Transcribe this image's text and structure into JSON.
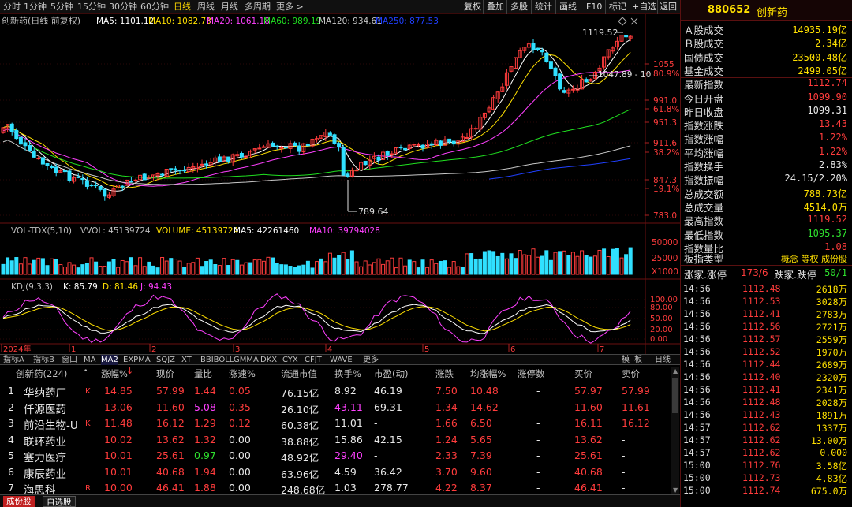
{
  "toolbar": {
    "periods": [
      "分时",
      "1分钟",
      "5分钟",
      "15分钟",
      "30分钟",
      "60分钟",
      "日线",
      "周线",
      "月线",
      "多周期",
      "更多 >"
    ],
    "active_period": "日线",
    "right_buttons": [
      "复权",
      "叠加",
      "多股",
      "统计",
      "画线",
      "F10",
      "标记",
      "+自选",
      "返回"
    ]
  },
  "chart": {
    "title": "创新药(日线 前复权)",
    "ma_labels": [
      {
        "text": "MA5: 1101.12",
        "color": "#ffffff"
      },
      {
        "text": "MA10: 1082.73",
        "color": "#ffe000"
      },
      {
        "text": "MA20: 1061.18",
        "color": "#ff40ff"
      },
      {
        "text": "MA60: 989.19",
        "color": "#20e020"
      },
      {
        "text": "MA120: 934.61",
        "color": "#c8c8c8"
      },
      {
        "text": "MA250: 877.53",
        "color": "#2040ff"
      }
    ],
    "price_axis": [
      "1055",
      "80.9%",
      "991.0",
      "61.8%",
      "951.3",
      "911.6",
      "38.2%",
      "847.3",
      "19.1%",
      "783.0"
    ],
    "high_label": "1119.52",
    "low_label": "789.64",
    "mid_label": "1047.89 - 10",
    "vol_labels": [
      {
        "text": "VOL-TDX(5,10)",
        "color": "#c0c0c0"
      },
      {
        "text": "VVOL: 45139724",
        "color": "#c0c0c0"
      },
      {
        "text": "VOLUME: 45139724",
        "color": "#ffe000"
      },
      {
        "text": "MA5: 42261460",
        "color": "#ffffff"
      },
      {
        "text": "MA10: 39794028",
        "color": "#ff40ff"
      }
    ],
    "vol_axis": [
      "50000",
      "25000",
      "X1000"
    ],
    "kdj_labels": [
      {
        "text": "KDJ(9,3,3)",
        "color": "#c0c0c0"
      },
      {
        "text": "K: 85.79",
        "color": "#ffffff"
      },
      {
        "text": "D: 81.46",
        "color": "#ffe000"
      },
      {
        "text": "J: 94.43",
        "color": "#ff40ff"
      }
    ],
    "kdj_axis": [
      "100.00",
      "80.00",
      "50.00",
      "20.00",
      "0.00"
    ],
    "date_axis": [
      "2024年",
      "1",
      "2",
      "3",
      "4",
      "5",
      "6",
      "7"
    ]
  },
  "tabs": {
    "items": [
      "指标A",
      "指标B",
      "窗口",
      "MA",
      "MA2",
      "EXPMA",
      "SQJZ",
      "XT",
      "BBIBOLL",
      "GMMA",
      "DKX",
      "CYX",
      "CFJT",
      "WAVE",
      "更多"
    ],
    "active": "MA2",
    "right": [
      "模",
      "板",
      "日线"
    ]
  },
  "table": {
    "title": "创新药(224)",
    "headers": [
      "涨幅%",
      "现价",
      "量比",
      "涨速%",
      "流通市值",
      "换手%",
      "市盈(动)",
      "涨跌",
      "均涨幅%",
      "涨停数",
      "买价",
      "卖价"
    ],
    "rows": [
      {
        "idx": "1",
        "name": "华纳药厂",
        "flag": "K",
        "chg": "14.85",
        "price": "57.99",
        "lb": "1.44",
        "speed": "0.05",
        "mcap": "76.15亿",
        "turn": "8.92",
        "pe": "46.19",
        "diff": "7.50",
        "avg": "10.48",
        "zt": "-",
        "bid": "57.97",
        "ask": "57.99"
      },
      {
        "idx": "2",
        "name": "仟源医药",
        "flag": "",
        "chg": "13.06",
        "price": "11.60",
        "lb": "5.08",
        "speed": "0.35",
        "mcap": "26.10亿",
        "turn": "43.11",
        "pe": "69.31",
        "diff": "1.34",
        "avg": "14.62",
        "zt": "-",
        "bid": "11.60",
        "ask": "11.61"
      },
      {
        "idx": "3",
        "name": "前沿生物-U",
        "flag": "K",
        "chg": "11.48",
        "price": "16.12",
        "lb": "1.29",
        "speed": "0.12",
        "mcap": "60.38亿",
        "turn": "11.01",
        "pe": "-",
        "diff": "1.66",
        "avg": "6.50",
        "zt": "-",
        "bid": "16.11",
        "ask": "16.12"
      },
      {
        "idx": "4",
        "name": "联环药业",
        "flag": "",
        "chg": "10.02",
        "price": "13.62",
        "lb": "1.32",
        "speed": "0.00",
        "mcap": "38.88亿",
        "turn": "15.86",
        "pe": "42.15",
        "diff": "1.24",
        "avg": "5.65",
        "zt": "-",
        "bid": "13.62",
        "ask": "-"
      },
      {
        "idx": "5",
        "name": "塞力医疗",
        "flag": "",
        "chg": "10.01",
        "price": "25.61",
        "lb": "0.97",
        "speed": "0.00",
        "mcap": "48.92亿",
        "turn": "29.40",
        "pe": "-",
        "diff": "2.33",
        "avg": "7.39",
        "zt": "-",
        "bid": "25.61",
        "ask": "-"
      },
      {
        "idx": "6",
        "name": "康辰药业",
        "flag": "",
        "chg": "10.01",
        "price": "40.68",
        "lb": "1.94",
        "speed": "0.00",
        "mcap": "63.96亿",
        "turn": "4.59",
        "pe": "36.42",
        "diff": "3.70",
        "avg": "9.60",
        "zt": "-",
        "bid": "40.68",
        "ask": "-"
      },
      {
        "idx": "7",
        "name": "海思科",
        "flag": "R",
        "chg": "10.00",
        "price": "46.41",
        "lb": "1.88",
        "speed": "0.00",
        "mcap": "248.68亿",
        "turn": "1.03",
        "pe": "278.77",
        "diff": "4.22",
        "avg": "8.37",
        "zt": "-",
        "bid": "46.41",
        "ask": "-"
      }
    ]
  },
  "bottom_tabs": [
    "成份股",
    "自选股"
  ],
  "side": {
    "code": "880652",
    "name": "创新药",
    "stats": [
      {
        "label": "Ａ股成交",
        "value": "14935.19亿",
        "color": "#ffe000"
      },
      {
        "label": "Ｂ股成交",
        "value": "2.34亿",
        "color": "#ffe000"
      },
      {
        "label": "国债成交",
        "value": "23500.48亿",
        "color": "#ffe000"
      },
      {
        "label": "基金成交",
        "value": "2499.05亿",
        "color": "#ffe000"
      },
      {
        "label": "最新指数",
        "value": "1112.74",
        "color": "#ff3c3c"
      },
      {
        "label": "今日开盘",
        "value": "1099.90",
        "color": "#ff3c3c"
      },
      {
        "label": "昨日收盘",
        "value": "1099.31",
        "color": "#e8e8e8"
      },
      {
        "label": "指数涨跌",
        "value": "13.43",
        "color": "#ff3c3c"
      },
      {
        "label": "指数涨幅",
        "value": "1.22%",
        "color": "#ff3c3c"
      },
      {
        "label": "平均涨幅",
        "value": "1.22%",
        "color": "#ff3c3c"
      },
      {
        "label": "指数换手",
        "value": "2.83%",
        "color": "#e8e8e8"
      },
      {
        "label": "指数振幅",
        "value": "24.15/2.20%",
        "color": "#e8e8e8"
      },
      {
        "label": "总成交额",
        "value": "788.73亿",
        "color": "#ffe000"
      },
      {
        "label": "总成交量",
        "value": "4514.0万",
        "color": "#ffe000"
      },
      {
        "label": "最高指数",
        "value": "1119.52",
        "color": "#ff3c3c"
      },
      {
        "label": "最低指数",
        "value": "1095.37",
        "color": "#2ee02e"
      },
      {
        "label": "指数量比",
        "value": "1.08",
        "color": "#ff3c3c"
      }
    ],
    "board_label": "板指类型",
    "board_value": "概念 等权 成份股",
    "updown_left_label": "涨家.涨停",
    "updown_left_value": "173/6",
    "updown_right_label": "跌家.跌停",
    "updown_right_value": "50/1",
    "ticks": [
      {
        "t": "14:56",
        "p": "1112.48",
        "v": "2618万"
      },
      {
        "t": "14:56",
        "p": "1112.53",
        "v": "3028万"
      },
      {
        "t": "14:56",
        "p": "1112.41",
        "v": "2783万"
      },
      {
        "t": "14:56",
        "p": "1112.56",
        "v": "2721万"
      },
      {
        "t": "14:56",
        "p": "1112.57",
        "v": "2559万"
      },
      {
        "t": "14:56",
        "p": "1112.52",
        "v": "1970万"
      },
      {
        "t": "14:56",
        "p": "1112.44",
        "v": "2689万"
      },
      {
        "t": "14:56",
        "p": "1112.40",
        "v": "2320万"
      },
      {
        "t": "14:56",
        "p": "1112.41",
        "v": "2341万"
      },
      {
        "t": "14:56",
        "p": "1112.48",
        "v": "2028万"
      },
      {
        "t": "14:56",
        "p": "1112.43",
        "v": "1891万"
      },
      {
        "t": "14:57",
        "p": "1112.62",
        "v": "1337万"
      },
      {
        "t": "14:57",
        "p": "1112.62",
        "v": "13.00万"
      },
      {
        "t": "14:57",
        "p": "1112.62",
        "v": "0.000"
      },
      {
        "t": "15:00",
        "p": "1112.76",
        "v": "3.58亿"
      },
      {
        "t": "15:00",
        "p": "1112.73",
        "v": "4.83亿"
      },
      {
        "t": "15:00",
        "p": "1112.74",
        "v": "675.0万"
      }
    ]
  }
}
